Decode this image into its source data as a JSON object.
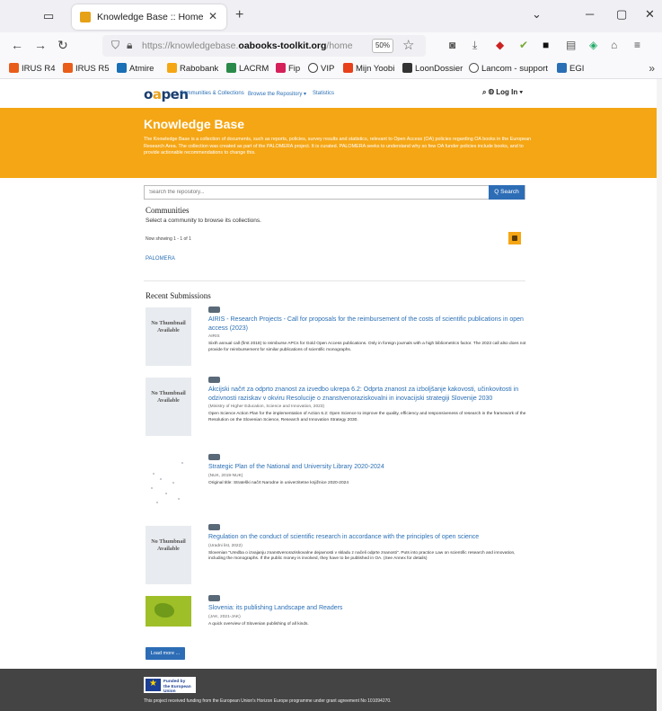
{
  "browser": {
    "tab_title": "Knowledge Base :: Home",
    "url_prefix": "https://knowledgebase.",
    "url_domain": "oabooks-toolkit.org",
    "url_suffix": "/home",
    "zoom": "50%",
    "bookmarks": [
      {
        "label": "IRUS R4",
        "color": "#e85d1a"
      },
      {
        "label": "IRUS R5",
        "color": "#e85d1a"
      },
      {
        "label": "Atmire",
        "color": "#1a6fb5"
      },
      {
        "label": "Rabobank",
        "color": "#f5a614"
      },
      {
        "label": "LACRM",
        "color": "#2a8a4a"
      },
      {
        "label": "Fip",
        "color": "#d6205a"
      },
      {
        "label": "VIP",
        "color": "#444444"
      },
      {
        "label": "Mijn Yoobi",
        "color": "#e8401a"
      },
      {
        "label": "LoonDossier",
        "color": "#333333"
      },
      {
        "label": "Lancom - support",
        "color": "#555555"
      },
      {
        "label": "EGI",
        "color": "#2a6fb5"
      }
    ]
  },
  "site": {
    "logo_prefix": "o",
    "logo_accent": "a",
    "logo_suffix": "pen",
    "nav": [
      "Communities & Collections",
      "Browse the Repository ▾",
      "Statistics"
    ],
    "login": "Log In ▾",
    "banner_title": "Knowledge Base",
    "banner_text": "The Knowledge Base is a collection of documents, such as reports, policies, survey results and statistics, relevant to Open Access (OA) policies regarding OA books in the European Research Area. The collection was created as part of the PALOMERA project. It is curated. PALOMERA seeks to understand why so few OA funder policies include books, and to provide actionable recommendations to change this.",
    "search_placeholder": "Search the repository...",
    "search_button": "Q Search",
    "communities_heading": "Communities",
    "communities_subtitle": "Select a community to browse its collections.",
    "showing": "Now showing 1 - 1 of 1",
    "community_link": "PALOMERA",
    "recent_heading": "Recent Submissions",
    "no_thumb": "No Thumbnail Available",
    "items": [
      {
        "title": "AIRIS - Research Projects - Call for proposals for the reimbursement of the costs of scientific publications in open access (2023)",
        "meta": "AIRIS",
        "desc": "Sixth annual call (first 2018) to reimburse APCs for Gold Open Access publications. Only in foreign journals with a high bibliometrics factor. The 2023 call also does not provide for reimbursement for similar publications of scientific monographs."
      },
      {
        "title": "Akcijski načrt za odprto znanost za izvedbo ukrepa 6.2: Odprta znanost za izboljšanje kakovosti, učinkovitosti in odzivnosti raziskav v okviru Resolucije o znanstvenoraziskovalni in inovacijski strategiji Slovenije 2030",
        "meta": "(Ministry of Higher Education, Science and Innovation, 2023)",
        "desc": "Open Science Action Plan for the implementation of Action 6.2: Open Science to improve the quality, efficiency and responsiveness of research in the framework of the Resolution on the Slovenian Science, Research and Innovation Strategy 2030."
      },
      {
        "title": "Strategic Plan of the National and University Library 2020-2024",
        "meta": "(NUK, 2019-NUK)",
        "desc": "Original title: Strateški načrt Narodne in univerzitetne knjižnice 2020-2024"
      },
      {
        "title": "Regulation on the conduct of scientific research in accordance with the principles of open science",
        "meta": "(Uradni list, 2022)",
        "desc": "Slovenian \"Uredba o izvajanju znanstvenoraziskovalne dejavnosti v skladu z načeli odprte znanosti\". Puts into practice Law on scientific research and innovation, including the monographs. If the public money is involved, they have to be published in OA. (See Annex for details)"
      },
      {
        "title": "Slovenia: its publishing Landscape and Readers",
        "meta": "(JAK, 2021-JAK)",
        "desc": "A quick overview of Slovenian publishing of all kinds."
      }
    ],
    "load_more": "Load more ...",
    "eu_label_1": "Funded by",
    "eu_label_2": "the European Union",
    "footer_text": "This project received funding from the European Union's Horizon Europe programme under grant agreement No 101094270."
  }
}
